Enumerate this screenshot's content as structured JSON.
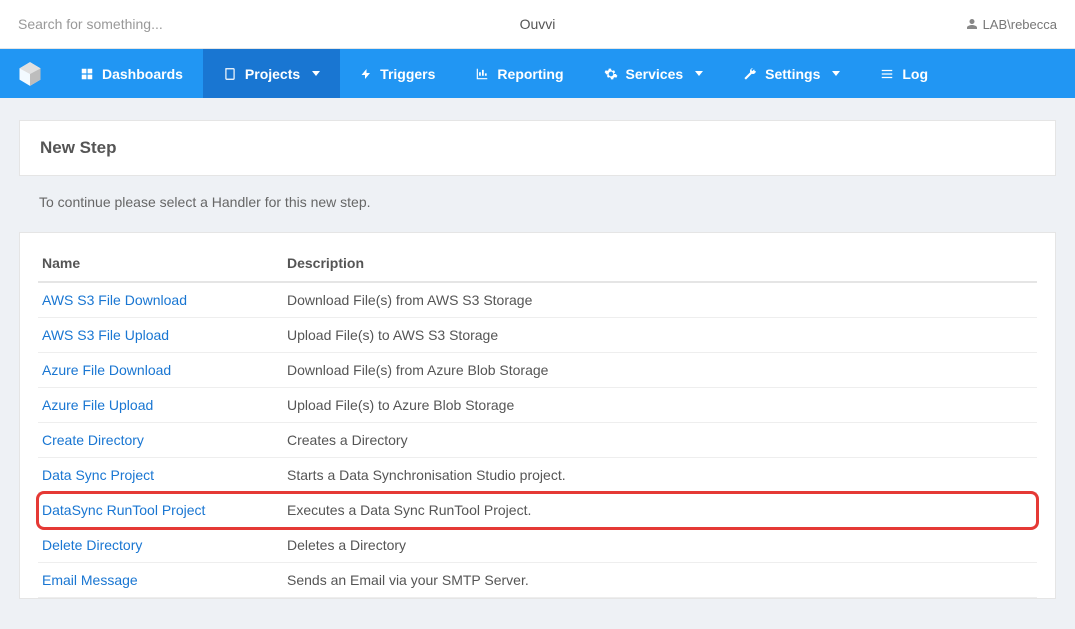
{
  "header": {
    "search_placeholder": "Search for something...",
    "app_title": "Ouvvi",
    "user_label": "LAB\\rebecca"
  },
  "nav": {
    "items": [
      {
        "label": "Dashboards",
        "dropdown": false
      },
      {
        "label": "Projects",
        "dropdown": true
      },
      {
        "label": "Triggers",
        "dropdown": false
      },
      {
        "label": "Reporting",
        "dropdown": false
      },
      {
        "label": "Services",
        "dropdown": true
      },
      {
        "label": "Settings",
        "dropdown": true
      },
      {
        "label": "Log",
        "dropdown": false
      }
    ]
  },
  "page": {
    "panel_title": "New Step",
    "instruction": "To continue please select a Handler for this new step."
  },
  "table": {
    "headers": {
      "name": "Name",
      "description": "Description"
    },
    "rows": [
      {
        "name": "AWS S3 File Download",
        "description": "Download File(s) from AWS S3 Storage"
      },
      {
        "name": "AWS S3 File Upload",
        "description": "Upload File(s) to AWS S3 Storage"
      },
      {
        "name": "Azure File Download",
        "description": "Download File(s) from Azure Blob Storage"
      },
      {
        "name": "Azure File Upload",
        "description": "Upload File(s) to Azure Blob Storage"
      },
      {
        "name": "Create Directory",
        "description": "Creates a Directory"
      },
      {
        "name": "Data Sync Project",
        "description": "Starts a Data Synchronisation Studio project."
      },
      {
        "name": "DataSync RunTool Project",
        "description": "Executes a Data Sync RunTool Project.",
        "highlight": true
      },
      {
        "name": "Delete Directory",
        "description": "Deletes a Directory"
      },
      {
        "name": "Email Message",
        "description": "Sends an Email via your SMTP Server."
      }
    ]
  }
}
